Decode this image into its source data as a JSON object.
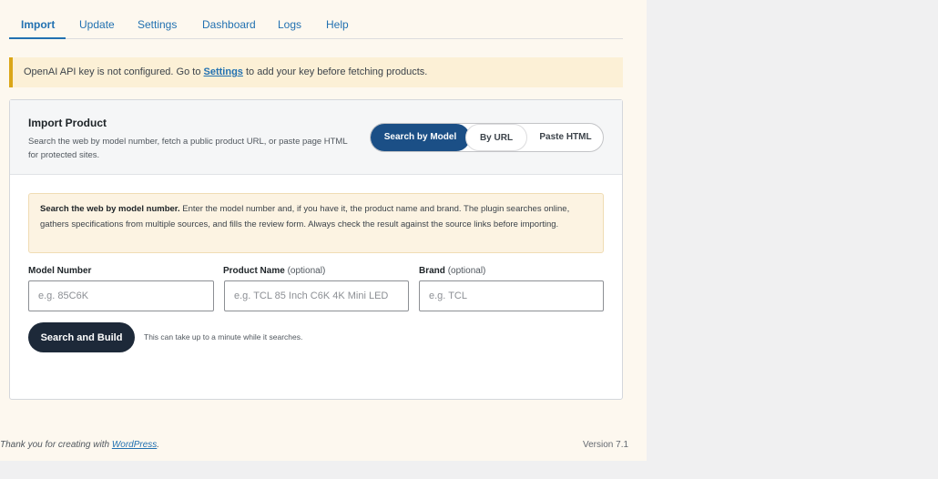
{
  "tabs": [
    {
      "label": "Import",
      "active": true
    },
    {
      "label": "Update"
    },
    {
      "label": "Settings"
    },
    {
      "label": "Dashboard"
    },
    {
      "label": "Logs"
    },
    {
      "label": "Help"
    }
  ],
  "notice": {
    "prefix": "OpenAI API key is not configured. Go to ",
    "link": "Settings",
    "suffix": " to add your key before fetching products."
  },
  "card": {
    "title": "Import Product",
    "description": "Search the web by model number, fetch a public product URL, or paste page HTML for protected sites.",
    "modes": [
      {
        "label": "Search by Model",
        "active": true
      },
      {
        "label": "By URL"
      },
      {
        "label": "Paste HTML"
      }
    ],
    "info": {
      "bold": "Search the web by model number.",
      "text": " Enter the model number and, if you have it, the product name and brand. The plugin searches online, gathers specifications from multiple sources, and fills the review form. Always check the result against the source links before importing."
    },
    "fields": {
      "model": {
        "label": "Model Number",
        "optional": "",
        "placeholder": "e.g. 85C6K"
      },
      "product": {
        "label": "Product Name",
        "optional": "(optional)",
        "placeholder": "e.g. TCL 85 Inch C6K 4K Mini LED"
      },
      "brand": {
        "label": "Brand",
        "optional": "(optional)",
        "placeholder": "e.g. TCL"
      }
    },
    "submit_label": "Search and Build",
    "hint": "This can take up to a minute while it searches."
  },
  "footer": {
    "prefix": "Thank you for creating with ",
    "link": "WordPress",
    "suffix": ".",
    "version": "Version 7.1"
  },
  "colors": {
    "accent": "#2271b1",
    "primary_button": "#1d2939",
    "segment_active": "#1b4f86",
    "notice_border": "#dba617",
    "page_bg": "#fdf8ef"
  }
}
